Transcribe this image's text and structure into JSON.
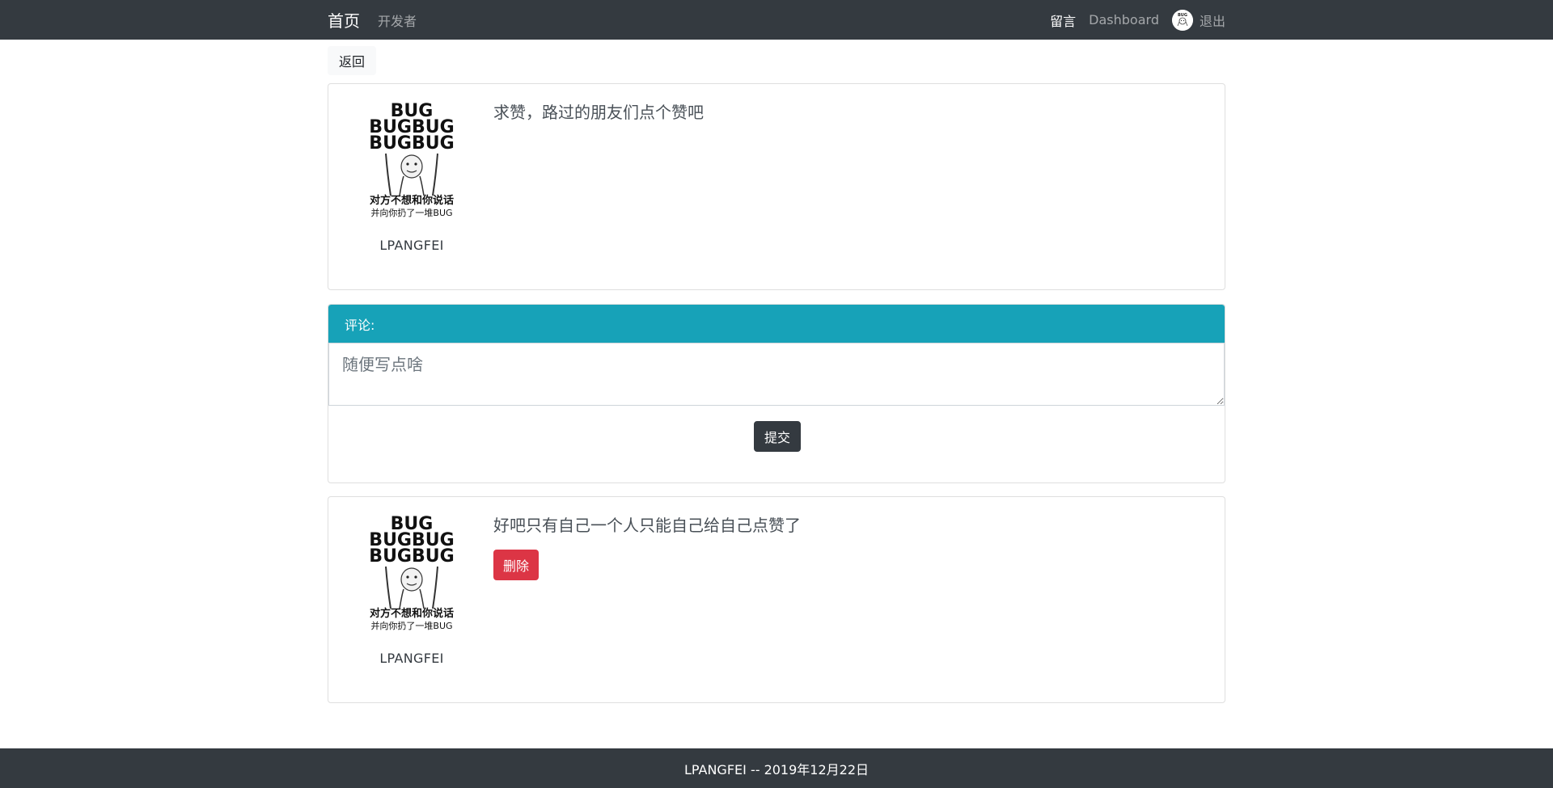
{
  "nav": {
    "brand": "首页",
    "developer": "开发者",
    "messages": "留言",
    "dashboard": "Dashboard",
    "logout": "退出"
  },
  "back_label": "返回",
  "post": {
    "author": "LPANGFEI",
    "content": "求赞，路过的朋友们点个赞吧",
    "avatar_lines": [
      "BUG",
      "BUGBUG",
      "BUGBUG",
      "对方不想和你说话",
      "并向你扔了一堆BUG"
    ]
  },
  "comment_form": {
    "header": "评论:",
    "placeholder": "随便写点啥",
    "submit_label": "提交"
  },
  "replies": [
    {
      "author": "LPANGFEI",
      "content": "好吧只有自己一个人只能自己给自己点赞了",
      "delete_label": "删除"
    }
  ],
  "footer": "LPANGFEI -- 2019年12月22日",
  "colors": {
    "navbar": "#343a40",
    "info_header": "#17a2b8",
    "danger": "#dc3545"
  }
}
